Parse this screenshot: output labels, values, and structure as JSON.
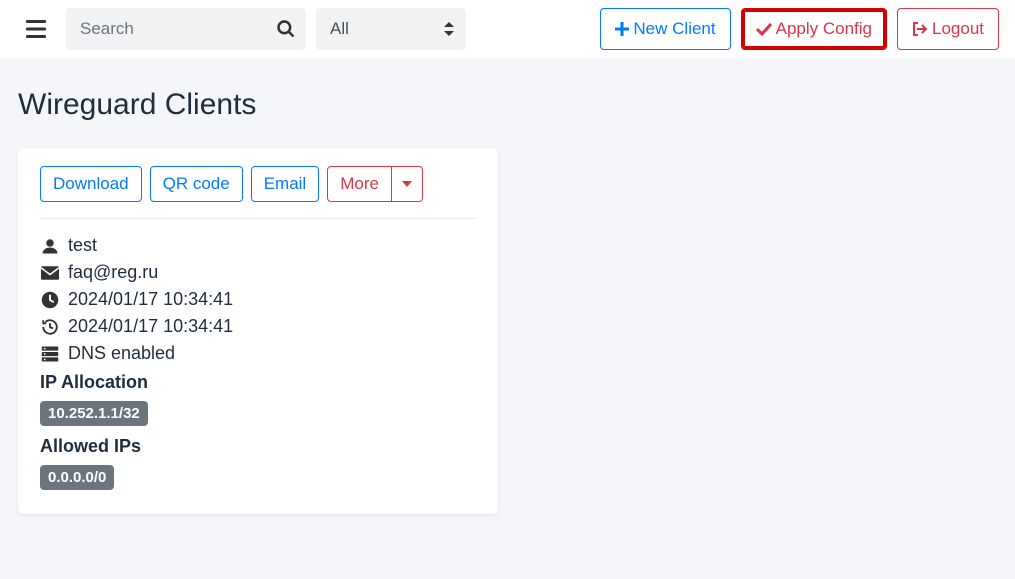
{
  "header": {
    "search_placeholder": "Search",
    "filter_selected": "All",
    "new_client_label": "New Client",
    "apply_config_label": "Apply Config",
    "logout_label": "Logout"
  },
  "page": {
    "title": "Wireguard Clients"
  },
  "client_card": {
    "actions": {
      "download": "Download",
      "qr_code": "QR code",
      "email": "Email",
      "more": "More"
    },
    "name": "test",
    "email": "faq@reg.ru",
    "created_at": "2024/01/17 10:34:41",
    "updated_at": "2024/01/17 10:34:41",
    "dns_status": "DNS enabled",
    "ip_allocation_label": "IP Allocation",
    "ip_allocations": [
      "10.252.1.1/32"
    ],
    "allowed_ips_label": "Allowed IPs",
    "allowed_ips": [
      "0.0.0.0/0"
    ]
  }
}
